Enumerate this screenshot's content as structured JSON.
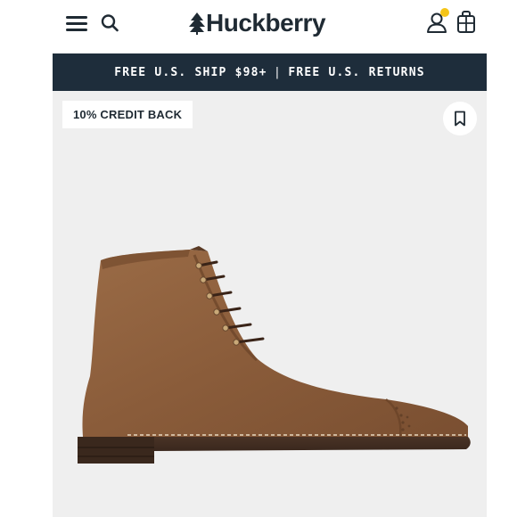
{
  "header": {
    "brand_name": "Huckberry",
    "menu_icon": "hamburger-menu-icon",
    "search_icon": "search-icon",
    "logo_icon": "tree-icon",
    "account_icon": "user-icon",
    "cart_icon": "bag-icon",
    "notification_dot_color": "#f5c518"
  },
  "promo": {
    "shipping": "FREE U.S. SHIP $98+",
    "separator": "|",
    "returns": "FREE U.S. RETURNS"
  },
  "product": {
    "badge": "10% CREDIT BACK",
    "bookmark_icon": "bookmark-icon",
    "image_subject": "brown suede cap-toe lace-up boot"
  },
  "colors": {
    "nav_text": "#1f2a33",
    "promo_bg": "#1e2d3b",
    "image_bg": "#efefef"
  }
}
